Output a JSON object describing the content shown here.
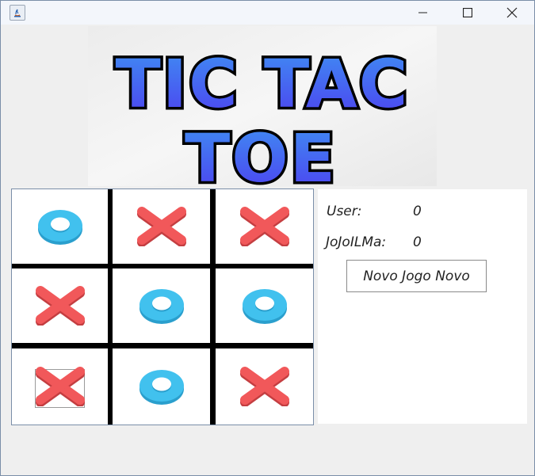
{
  "window": {
    "title": "",
    "controls": [
      "minimize-icon",
      "maximize-icon",
      "close-icon"
    ]
  },
  "banner": {
    "line1": "TIC TAC",
    "line2": "TOE",
    "text_color": "#4a63f0",
    "outline_color": "#000000"
  },
  "board": {
    "cells": [
      "O",
      "X",
      "X",
      "X",
      "O",
      "O",
      "X",
      "O",
      "X"
    ],
    "selected_index": 6,
    "o_color": "#41c1ee",
    "x_color": "#f1585a"
  },
  "scoreboard": {
    "user_label": "User:",
    "user_score": "0",
    "cpu_label": "JoJoILMa:",
    "cpu_score": "0"
  },
  "new_game_button": {
    "label": "Novo Jogo Novo"
  }
}
